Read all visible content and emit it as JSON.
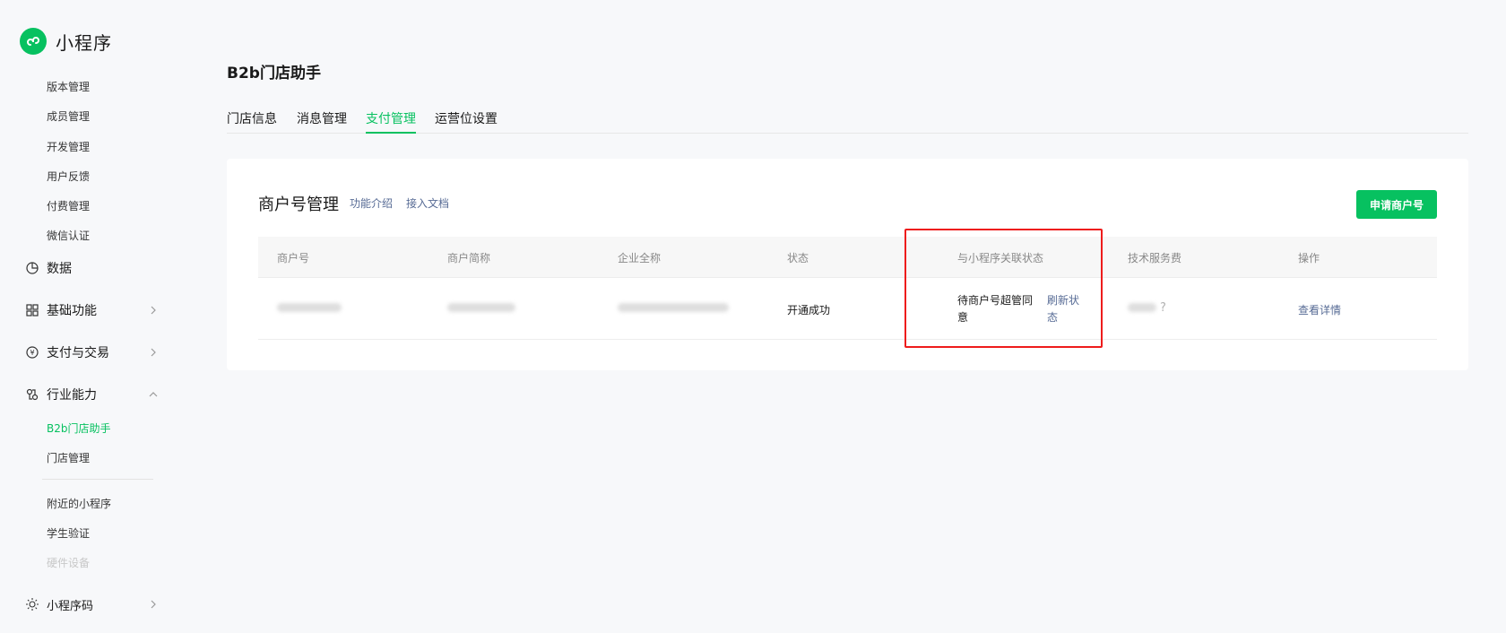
{
  "app": {
    "title": "小程序"
  },
  "sidebar": {
    "top_items": [
      {
        "label": "版本管理"
      },
      {
        "label": "成员管理"
      },
      {
        "label": "开发管理"
      },
      {
        "label": "用户反馈"
      },
      {
        "label": "付费管理"
      },
      {
        "label": "微信认证"
      }
    ],
    "groups": {
      "data": {
        "label": "数据",
        "icon": "pie-chart-icon"
      },
      "basic": {
        "label": "基础功能",
        "icon": "grid-icon"
      },
      "payment": {
        "label": "支付与交易",
        "icon": "yuan-icon"
      },
      "industry": {
        "label": "行业能力",
        "icon": "industry-icon"
      },
      "qrcode": {
        "label": "小程序码",
        "icon": "sun-icon"
      }
    },
    "industry_items": [
      {
        "label": "B2b门店助手",
        "active": true
      },
      {
        "label": "门店管理"
      }
    ],
    "other_items": [
      {
        "label": "附近的小程序"
      },
      {
        "label": "学生验证"
      },
      {
        "label": "硬件设备"
      }
    ]
  },
  "main": {
    "page_title": "B2b门店助手",
    "tabs": [
      {
        "label": "门店信息"
      },
      {
        "label": "消息管理"
      },
      {
        "label": "支付管理",
        "active": true
      },
      {
        "label": "运营位设置"
      }
    ],
    "card": {
      "title": "商户号管理",
      "links": [
        "功能介绍",
        "接入文档"
      ],
      "apply_button": "申请商户号",
      "columns": [
        "商户号",
        "商户简称",
        "企业全称",
        "状态",
        "与小程序关联状态",
        "技术服务费",
        "操作"
      ],
      "row": {
        "status": "开通成功",
        "relation_status_line1": "待商户号超管同",
        "relation_status_line2": "意",
        "refresh_line1": "刷新状",
        "refresh_line2": "态",
        "fee_help": "?",
        "action": "查看详情"
      }
    }
  },
  "colors": {
    "accent": "#07c160",
    "link": "#576b95",
    "highlight": "#ee1c1c"
  }
}
